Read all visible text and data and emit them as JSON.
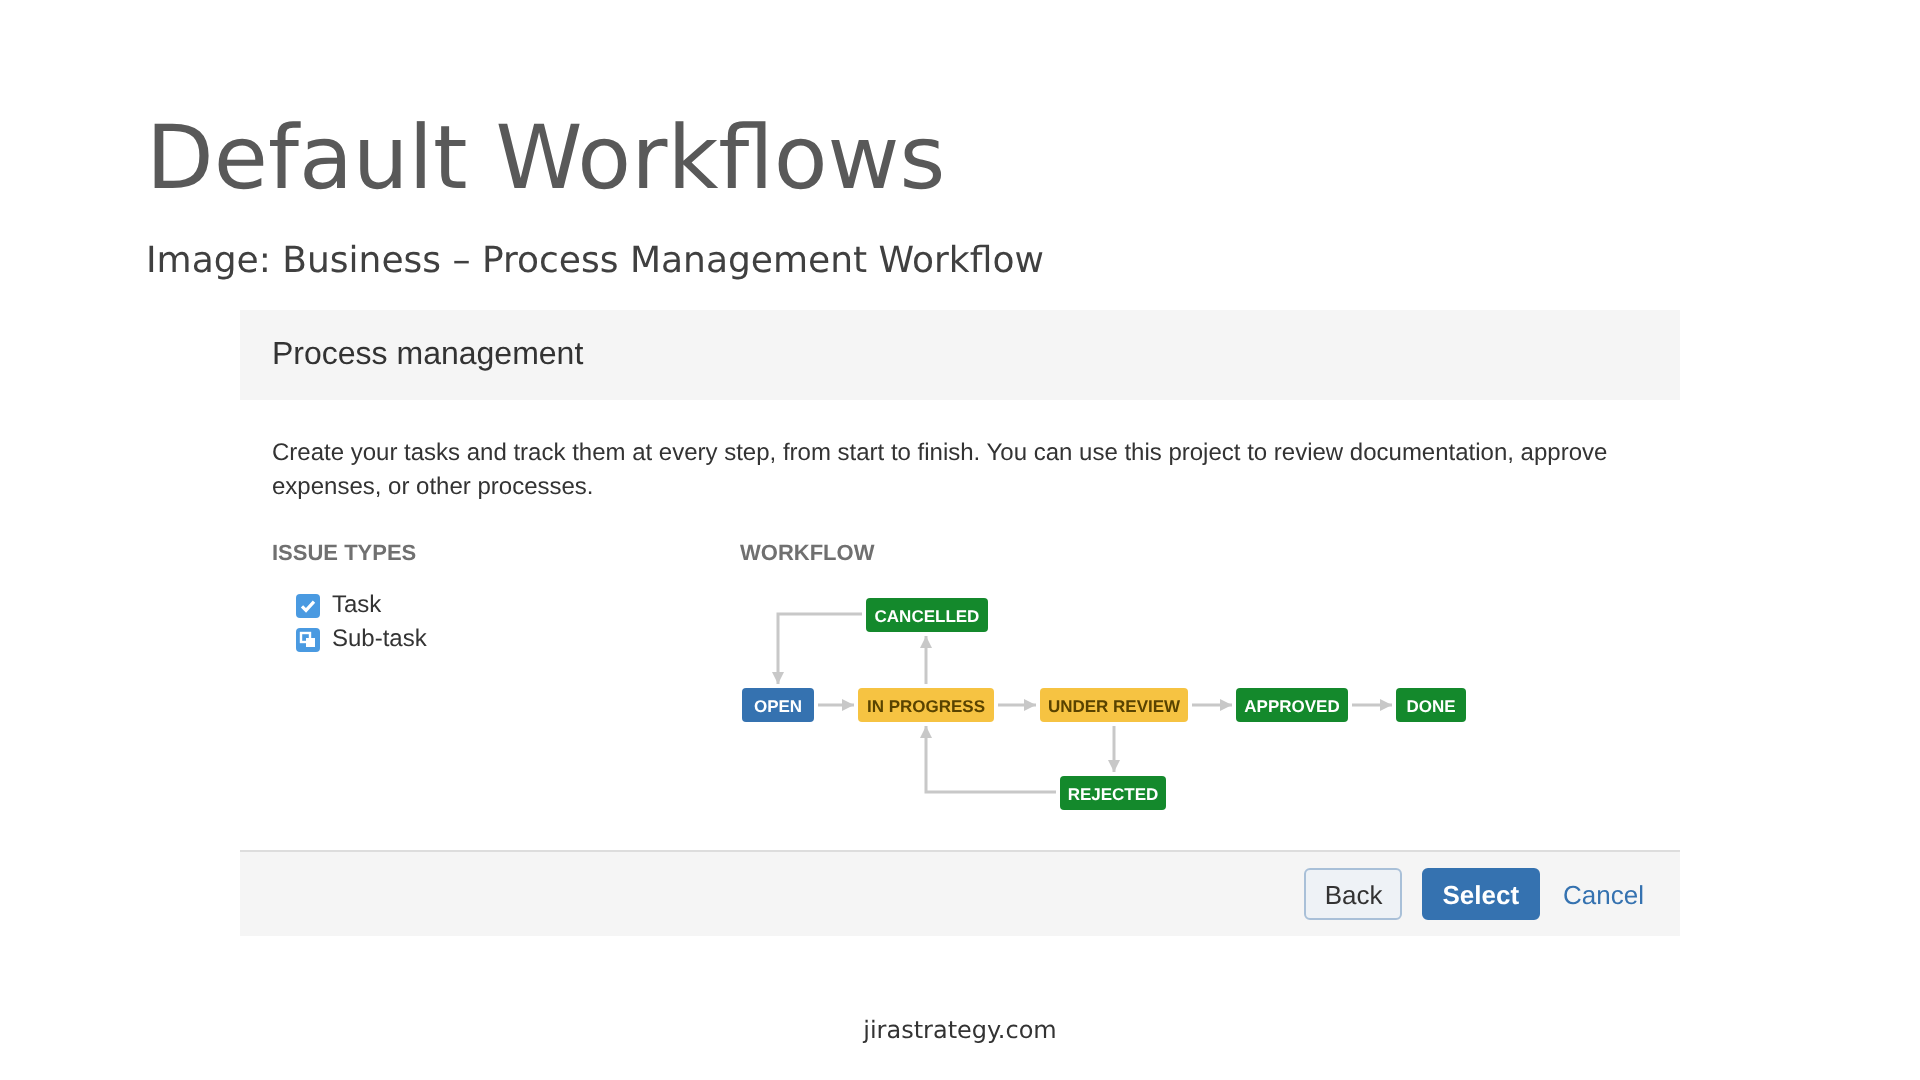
{
  "slide": {
    "title": "Default Workflows",
    "caption": "Image: Business – Process Management Workflow",
    "footer": "jirastrategy.com"
  },
  "dialog": {
    "title": "Process management",
    "description": "Create your tasks and track them at every step, from start to finish. You can use this project to review documentation, approve expenses, or other processes.",
    "issue_types": {
      "heading": "ISSUE TYPES",
      "items": [
        {
          "kind": "task",
          "label": "Task"
        },
        {
          "kind": "subtask",
          "label": "Sub-task"
        }
      ]
    },
    "workflow": {
      "heading": "WORKFLOW",
      "statuses": [
        {
          "label": "CANCELLED",
          "color": "#14892c"
        },
        {
          "label": "OPEN",
          "color": "#3572b0"
        },
        {
          "label": "IN PROGRESS",
          "color": "#f6c342"
        },
        {
          "label": "UNDER REVIEW",
          "color": "#f6c342"
        },
        {
          "label": "APPROVED",
          "color": "#14892c"
        },
        {
          "label": "DONE",
          "color": "#14892c"
        },
        {
          "label": "REJECTED",
          "color": "#14892c"
        }
      ]
    },
    "buttons": [
      {
        "kind": "secondary",
        "label": "Back"
      },
      {
        "kind": "primary",
        "label": "Select"
      },
      {
        "kind": "link",
        "label": "Cancel"
      }
    ]
  }
}
